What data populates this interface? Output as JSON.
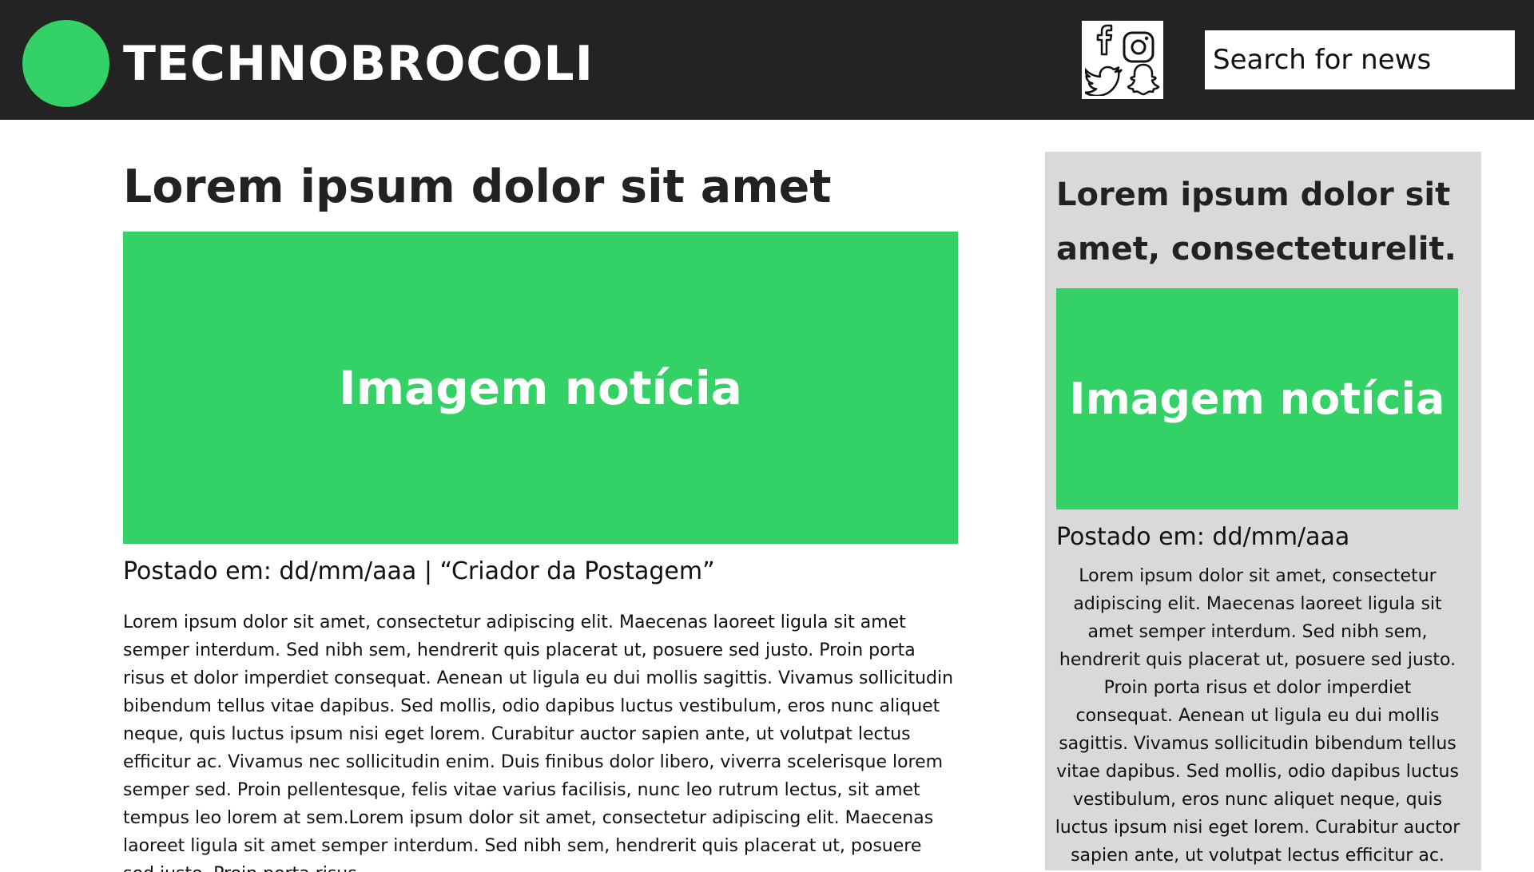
{
  "header": {
    "brand": "TECHNOBROCOLI",
    "social_icons": [
      "facebook-icon",
      "instagram-icon",
      "twitter-icon",
      "snapchat-icon"
    ],
    "search_placeholder": "Search for news"
  },
  "main_article": {
    "title": "Lorem ipsum dolor sit amet",
    "image_label": "Imagem notícia",
    "meta": "Postado em: dd/mm/aaa | “Criador da Postagem”",
    "body": "Lorem ipsum dolor sit amet, consectetur adipiscing elit. Maecenas laoreet ligula sit amet semper interdum. Sed nibh sem, hendrerit quis placerat ut, posuere sed justo. Proin porta risus et dolor imperdiet consequat. Aenean ut ligula eu dui mollis sagittis. Vivamus sollicitudin bibendum tellus vitae dapibus. Sed mollis, odio dapibus luctus vestibulum, eros nunc aliquet neque, quis luctus ipsum nisi eget lorem. Curabitur auctor sapien ante, ut volutpat lectus efficitur ac. Vivamus nec sollicitudin enim. Duis finibus dolor libero, viverra scelerisque lorem semper sed. Proin pellentesque, felis vitae varius facilisis, nunc leo rutrum lectus, sit amet tempus leo lorem at sem.Lorem ipsum dolor sit amet, consectetur adipiscing elit. Maecenas laoreet ligula sit amet semper interdum. Sed nibh sem, hendrerit quis placerat ut, posuere sed justo. Proin porta risus"
  },
  "side_article": {
    "title": "Lorem ipsum dolor sit amet, consecteturelit.",
    "image_label": "Imagem notícia",
    "meta": "Postado em: dd/mm/aaa",
    "body": "Lorem ipsum dolor sit amet, consectetur adipiscing elit. Maecenas laoreet ligula sit amet semper interdum. Sed nibh sem, hendrerit quis placerat ut, posuere sed justo. Proin porta risus et dolor imperdiet consequat. Aenean ut ligula eu dui mollis sagittis. Vivamus sollicitudin bibendum tellus vitae dapibus. Sed mollis, odio dapibus luctus vestibulum, eros nunc aliquet neque, quis luctus ipsum nisi eget lorem. Curabitur auctor sapien ante, ut volutpat lectus efficitur ac."
  },
  "colors": {
    "header_bg": "#232323",
    "accent_green": "#33d166",
    "sidebar_bg": "#d9d9d9",
    "text_dark": "#222222"
  }
}
